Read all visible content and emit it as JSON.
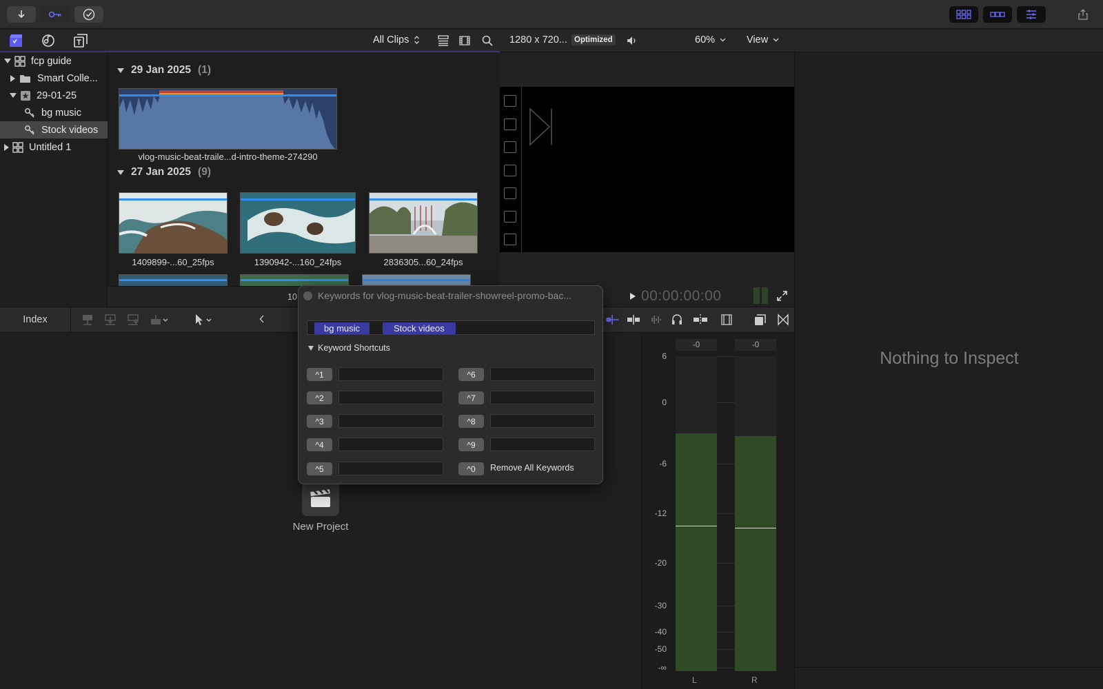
{
  "toolbar": {
    "left_buttons": [
      "import-icon",
      "keyword-icon",
      "checkmark-icon"
    ],
    "right_buttons": [
      "browser-layout-icon",
      "timeline-layout-icon",
      "inspector-layout-icon",
      "share-icon"
    ]
  },
  "browser_header": {
    "filter_label": "All Clips",
    "icons": [
      "libraries-icon",
      "photos-audio-icon",
      "titles-generators-icon",
      "list-view-icon",
      "filmstrip-icon",
      "search-icon"
    ]
  },
  "viewer_header": {
    "resolution": "1280 x 720...",
    "badge": "Optimized",
    "zoom": "60%",
    "view_label": "View"
  },
  "sidebar": {
    "items": [
      {
        "label": "fcp guide",
        "level": 0,
        "expanded": true,
        "icon": "library-icon"
      },
      {
        "label": "Smart Colle...",
        "level": 1,
        "expanded": false,
        "icon": "folder-icon"
      },
      {
        "label": "29-01-25",
        "level": 1,
        "expanded": true,
        "icon": "event-icon"
      },
      {
        "label": "bg music",
        "level": 2,
        "icon": "keyword-collection-icon"
      },
      {
        "label": "Stock videos",
        "level": 2,
        "icon": "keyword-collection-icon",
        "selected": true
      },
      {
        "label": "Untitled 1",
        "level": 0,
        "expanded": false,
        "icon": "library-icon"
      }
    ]
  },
  "browser": {
    "groups": [
      {
        "date": "29 Jan 2025",
        "count": "(1)"
      },
      {
        "date": "27 Jan 2025",
        "count": "(9)"
      }
    ],
    "audio_clip": "vlog-music-beat-traile...d-intro-theme-274290",
    "video_clips": [
      "1409899-...60_25fps",
      "1390942-...160_24fps",
      "2836305...60_24fps"
    ],
    "footer_partial": "10"
  },
  "viewer": {
    "timecode": "00:00:00:00"
  },
  "timeline_bar": {
    "index_label": "Index"
  },
  "timeline": {
    "new_project_label": "New Project"
  },
  "meters": {
    "peak_left": "-0",
    "peak_right": "-0",
    "scale": [
      "6",
      "0",
      "-6",
      "-12",
      "-20",
      "-30",
      "-40",
      "-50",
      "-∞"
    ],
    "channel_left": "L",
    "channel_right": "R",
    "level_left_db": -3,
    "level_right_db": -3.3,
    "hold_left_db": -14,
    "hold_right_db": -14.3
  },
  "inspector": {
    "empty_text": "Nothing to Inspect"
  },
  "keyword_popover": {
    "title": "Keywords for vlog-music-beat-trailer-showreel-promo-bac...",
    "tags": [
      "bg music",
      "Stock videos"
    ],
    "section_label": "Keyword Shortcuts",
    "shortcuts_left": [
      "^1",
      "^2",
      "^3",
      "^4",
      "^5"
    ],
    "shortcuts_right": [
      "^6",
      "^7",
      "^8",
      "^9",
      "^0"
    ],
    "remove_all_label": "Remove All Keywords"
  },
  "colors": {
    "accent": "#5b5bf0",
    "keyword_tag_bg": "#3b3aa0",
    "meter_green": "#2f4a24",
    "playhead_blue": "#2f8df0"
  }
}
